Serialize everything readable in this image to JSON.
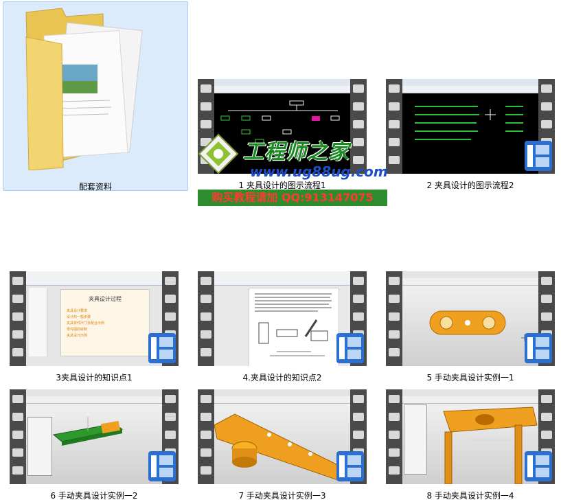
{
  "items": [
    {
      "id": "folder",
      "label": "配套资料",
      "kind": "folder"
    },
    {
      "id": "v1",
      "label": "1 夹具设计的图示流程1",
      "kind": "video",
      "screen": "cad-flow"
    },
    {
      "id": "v2",
      "label": "2 夹具设计的图示流程2",
      "kind": "video",
      "screen": "cad-text"
    },
    {
      "id": "v3",
      "label": "3夹具设计的知识点1",
      "kind": "video",
      "screen": "ppt"
    },
    {
      "id": "v4",
      "label": "4.夹具设计的知识点2",
      "kind": "video",
      "screen": "doc"
    },
    {
      "id": "v5",
      "label": "5 手动夹具设计实例一1",
      "kind": "video",
      "screen": "3d-plate"
    },
    {
      "id": "v6",
      "label": "6 手动夹具设计实例一2",
      "kind": "video",
      "screen": "3d-green"
    },
    {
      "id": "v7",
      "label": "7 手动夹具设计实例一3",
      "kind": "video",
      "screen": "3d-bar"
    },
    {
      "id": "v8",
      "label": "8 手动夹具设计实例一4",
      "kind": "video",
      "screen": "3d-legs"
    }
  ],
  "ppt": {
    "title": "夹具设计过程",
    "bullets": [
      "夹具设计要求",
      "设计的一般步骤",
      "夹具零件尺寸及配合示例",
      "零件图的绘制",
      "夹具设计示例"
    ]
  },
  "watermark": {
    "brand": "工程师之家",
    "url": "www.ug88ug.com",
    "banner": "购买教程请加 QQ:913147075"
  },
  "colors": {
    "selection": "#dcebfc",
    "film": "#4a4a4a",
    "orange": "#f0a020",
    "green": "#2e9a2e"
  }
}
